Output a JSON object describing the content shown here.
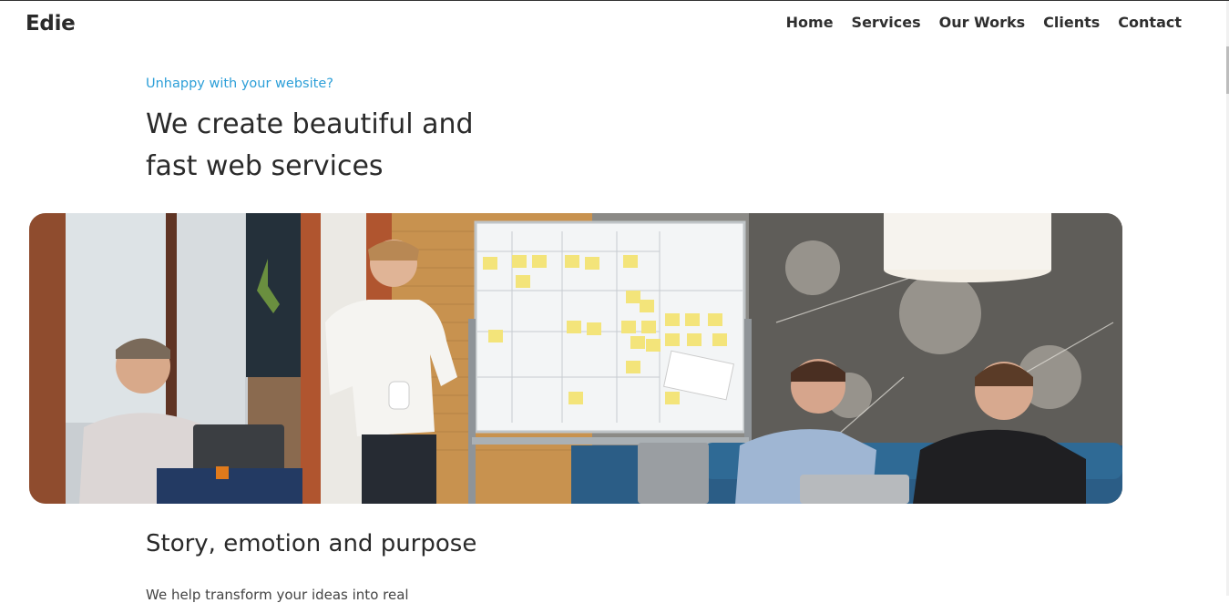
{
  "header": {
    "logo": "Edie",
    "nav": [
      "Home",
      "Services",
      "Our Works",
      "Clients",
      "Contact"
    ]
  },
  "hero": {
    "eyebrow": "Unhappy with your website?",
    "headline_line1": "We create beautiful and",
    "headline_line2": "fast web services",
    "image_alt": "team meeting at a whiteboard"
  },
  "section": {
    "title": "Story, emotion and purpose",
    "body": "We help transform your ideas into real"
  },
  "colors": {
    "accent": "#2d9fd8",
    "text": "#2a2a2a"
  }
}
